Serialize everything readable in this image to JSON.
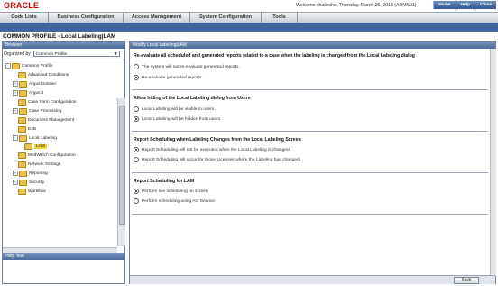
{
  "header": {
    "logo": "ORACLE",
    "welcome": "Welcome shaileshe, Thursday, March 25, 2010 (ARMS01)",
    "links": [
      "Home",
      "Help",
      "Close"
    ]
  },
  "menu": [
    "Code Lists",
    "Business Configuration",
    "Access Management",
    "System Configuration",
    "Tools"
  ],
  "page_title": "COMMON PROFILE - Local Labeling|LAM",
  "browser": {
    "title": "Browser",
    "organized_by_label": "Organized by",
    "organized_by_value": "Common Profile",
    "help_title": "Help Text",
    "tree": [
      {
        "label": "Common Profile",
        "expander": "-"
      },
      {
        "label": "Advanced Conditions",
        "expander": ""
      },
      {
        "label": "Argus Dossier",
        "expander": "+"
      },
      {
        "label": "Argus J",
        "expander": "+"
      },
      {
        "label": "Case Form Configuration",
        "expander": ""
      },
      {
        "label": "Case Processing",
        "expander": "+"
      },
      {
        "label": "Document Management",
        "expander": ""
      },
      {
        "label": "E2B",
        "expander": ""
      },
      {
        "label": "Local Labeling",
        "expander": "-"
      },
      {
        "label": "LAM",
        "expander": ""
      },
      {
        "label": "MedWatch Configuration",
        "expander": ""
      },
      {
        "label": "Network Settings",
        "expander": ""
      },
      {
        "label": "Reporting",
        "expander": "+"
      },
      {
        "label": "Security",
        "expander": "+"
      },
      {
        "label": "Workflow",
        "expander": ""
      }
    ]
  },
  "form": {
    "title": "Modify Local Labeling|LAM",
    "sections": [
      {
        "title": "Re-evaluate all scheduled and generated reports related to a case when the labeling is changed from the Local Labeling dialog",
        "options": [
          {
            "label": "The system will not re-evaluate generated reports.",
            "checked": false
          },
          {
            "label": "Re-evaluate generated reports.",
            "checked": true
          }
        ]
      },
      {
        "title": "Allow hiding of the Local Labeling dialog from Users",
        "options": [
          {
            "label": "Local Labeling will be visible to users.",
            "checked": false
          },
          {
            "label": "Local Labeling will be hidden from users.",
            "checked": true
          }
        ]
      },
      {
        "title": "Report Scheduling when Labeling Changes from the Local Labeling Screen",
        "options": [
          {
            "label": "Report Scheduling will not be executed when the Local Labeling is changed.",
            "checked": true
          },
          {
            "label": "Report Scheduling will occur for those Licenses where the Labeling has changed.",
            "checked": false
          }
        ]
      },
      {
        "title": "Report Scheduling for LAM",
        "options": [
          {
            "label": "Perform live scheduling on screen",
            "checked": true
          },
          {
            "label": "Perform scheduling using AG Service",
            "checked": false
          }
        ]
      }
    ],
    "save_label": "Save"
  }
}
